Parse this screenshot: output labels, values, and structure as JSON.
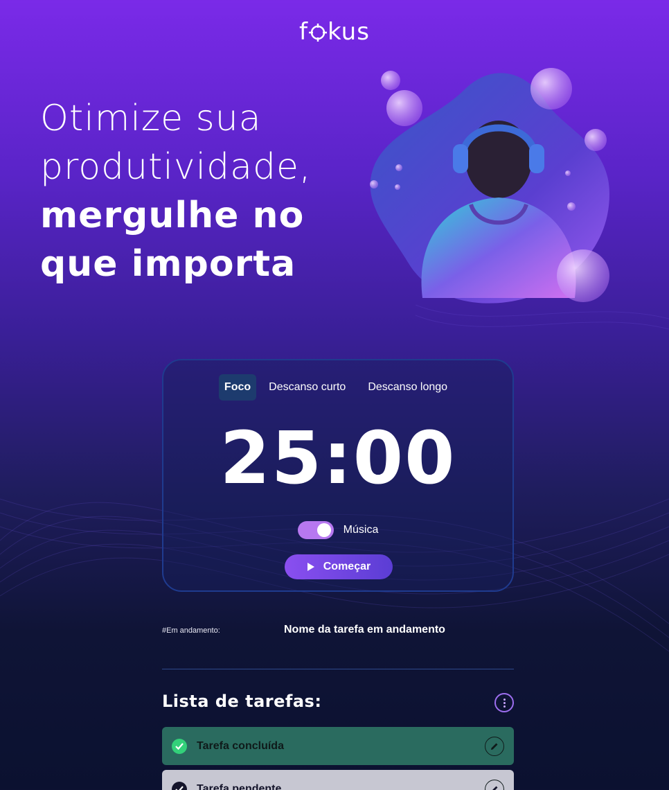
{
  "header": {
    "logo": "fokus",
    "logo_icon": "target-icon"
  },
  "hero": {
    "line1": "Otimize sua",
    "line2": "produtividade,",
    "line3": "mergulhe no",
    "line4": "que importa"
  },
  "timer_card": {
    "tabs": [
      {
        "label": "Foco",
        "active": true
      },
      {
        "label": "Descanso curto",
        "active": false
      },
      {
        "label": "Descanso longo",
        "active": false
      }
    ],
    "time": "25:00",
    "music_label": "Música",
    "music_on": true,
    "start_label": "Começar",
    "start_icon": "play-icon"
  },
  "in_progress": {
    "label": "#Em andamento:",
    "value": "Nome da tarefa em andamento"
  },
  "tasks": {
    "title": "Lista de tarefas:",
    "menu_icon": "more-vertical-icon",
    "items": [
      {
        "label": "Tarefa concluída",
        "status": "done",
        "icon": "check-circle-icon"
      },
      {
        "label": "Tarefa pendente",
        "status": "pending",
        "icon": "check-circle-icon"
      }
    ]
  },
  "colors": {
    "accent": "#b778f0",
    "done_bg": "#2a6b5f",
    "done_check": "#33d17a",
    "pending_bg": "#c7c7d2",
    "card_border": "#1f3b8f"
  }
}
